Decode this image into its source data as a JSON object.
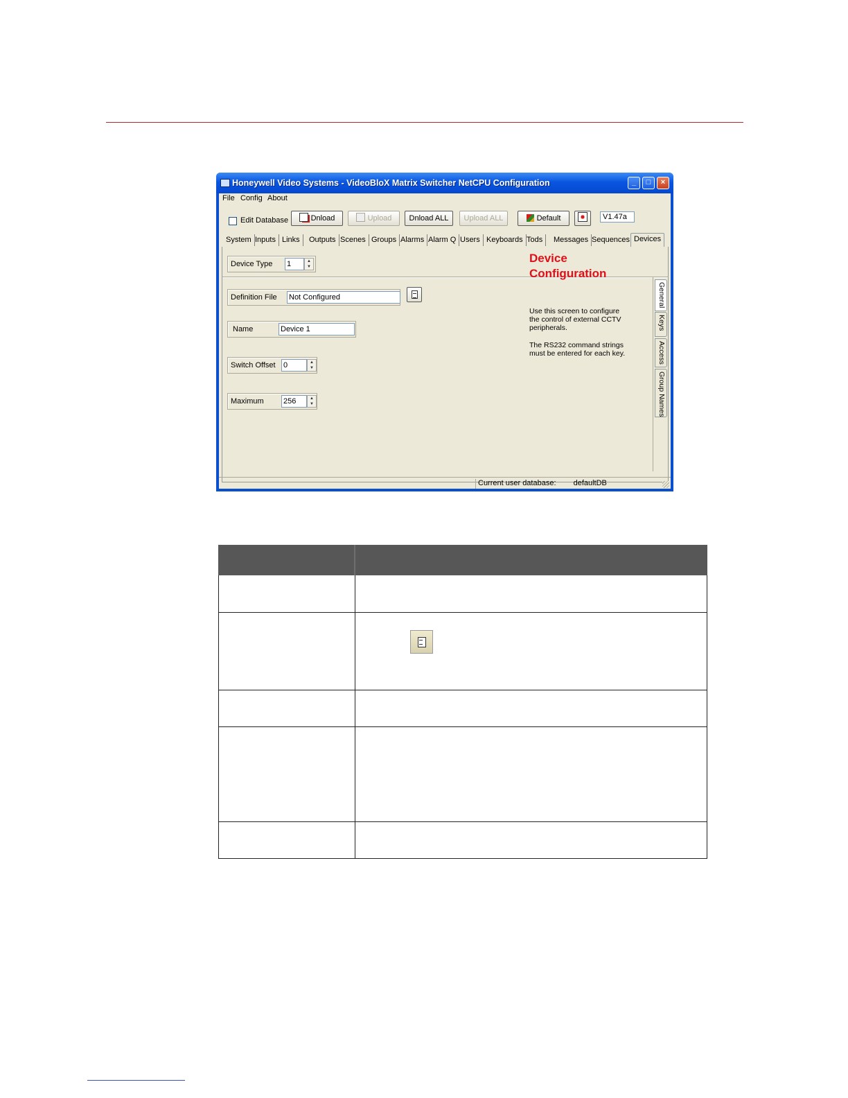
{
  "window": {
    "title": "Honeywell Video Systems - VideoBloX Matrix Switcher NetCPU Configuration",
    "controls": [
      "_",
      "□",
      "×"
    ]
  },
  "menu": [
    "File",
    "Config",
    "About"
  ],
  "toolbar": {
    "edit_database_label": "Edit Database",
    "edit_database_checked": false,
    "buttons": {
      "dnload": "Dnload",
      "upload": "Upload",
      "dnload_all": "Dnload ALL",
      "upload_all": "Upload ALL",
      "default": "Default"
    },
    "version": "V1.47a"
  },
  "tabs": [
    "System",
    "Inputs",
    "Links",
    "Outputs",
    "Scenes",
    "Groups",
    "Alarms",
    "Alarm Q",
    "Users",
    "Keyboards",
    "Tods",
    "Messages",
    "Sequences",
    "Devices"
  ],
  "active_tab": "Devices",
  "form": {
    "device_type_label": "Device Type",
    "device_type_value": "1",
    "definition_file_label": "Definition File",
    "definition_file_value": "Not Configured",
    "name_label": "Name",
    "name_value": "Device 1",
    "switch_offset_label": "Switch Offset",
    "switch_offset_value": "0",
    "maximum_label": "Maximum",
    "maximum_value": "256"
  },
  "info": {
    "title_line1": "Device",
    "title_line2": "Configuration",
    "text1_line1": "Use this screen to configure",
    "text1_line2": "the control of external CCTV",
    "text1_line3": "peripherals.",
    "text2_line1": "The RS232 command strings",
    "text2_line2": "must be entered for each key."
  },
  "side_tabs": [
    "General",
    "Keys",
    "Access",
    "Group Names"
  ],
  "status": {
    "label": "Current user database:",
    "value": "defaultDB"
  },
  "colors": {
    "title_bar": "#0a56e0",
    "accent_red": "#e0101a",
    "table_header": "#575757"
  }
}
